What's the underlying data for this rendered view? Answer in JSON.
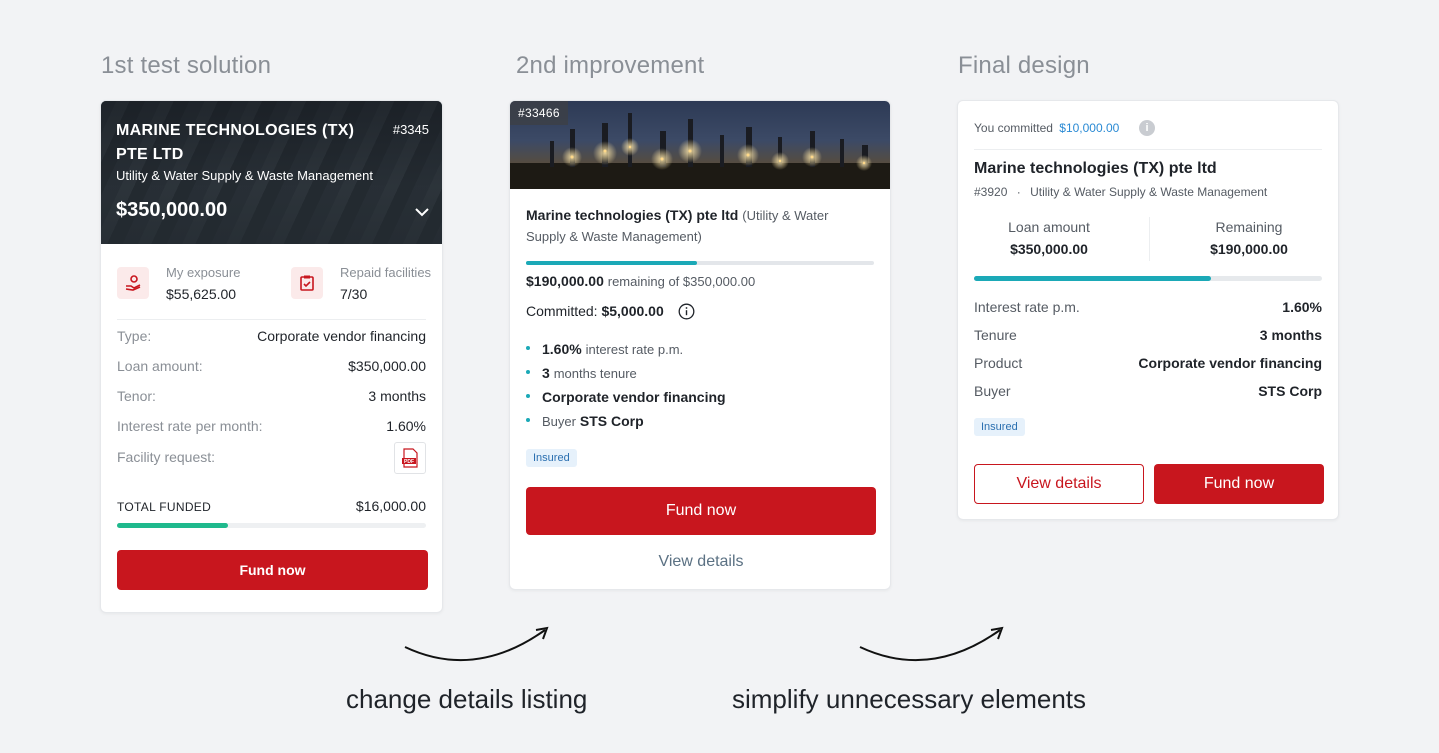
{
  "columns": {
    "first": "1st test solution",
    "second": "2nd improvement",
    "final": "Final design"
  },
  "card1": {
    "company": "MARINE TECHNOLOGIES (TX) PTE LTD",
    "id": "#3345",
    "industry": "Utility & Water Supply & Waste Management",
    "amount": "$350,000.00",
    "exposure_label": "My exposure",
    "exposure_value": "$55,625.00",
    "repaid_label": "Repaid facilities",
    "repaid_value": "7/30",
    "rows": [
      {
        "k": "Type:",
        "v": "Corporate vendor financing"
      },
      {
        "k": "Loan amount:",
        "v": "$350,000.00"
      },
      {
        "k": "Tenor:",
        "v": "3 months"
      },
      {
        "k": "Interest rate per month:",
        "v": "1.60%"
      }
    ],
    "facility_label": "Facility request:",
    "pdf_label": "PDF",
    "total_label": "TOTAL FUNDED",
    "total_value": "$16,000.00",
    "funded_fraction": 0.36,
    "fund_button": "Fund now"
  },
  "card2": {
    "badge": "#33466",
    "company": "Marine technologies (TX) pte ltd",
    "industry": "(Utility & Water Supply & Waste Management)",
    "remaining_amount": "$190,000.00",
    "remaining_text": "remaining of $350,000.00",
    "progress_fraction": 0.49,
    "committed_label": "Committed:",
    "committed_value": "$5,000.00",
    "bullets": [
      {
        "strong": "1.60%",
        "rest": "interest rate p.m."
      },
      {
        "strong": "3",
        "rest": "months tenure"
      },
      {
        "strong": "Corporate vendor financing",
        "rest": ""
      },
      {
        "pre": "Buyer",
        "strong": "STS Corp"
      }
    ],
    "tag": "Insured",
    "fund_button": "Fund now",
    "view_link": "View details"
  },
  "card3": {
    "committed_label": "You committed",
    "committed_value": "$10,000.00",
    "company": "Marine technologies (TX) pte ltd",
    "id": "#3920",
    "separator": "·",
    "industry": "Utility & Water Supply & Waste Management",
    "loan_label": "Loan amount",
    "loan_value": "$350,000.00",
    "remaining_label": "Remaining",
    "remaining_value": "$190,000.00",
    "progress_fraction": 0.68,
    "rows": [
      {
        "k": "Interest rate p.m.",
        "v": "1.60%"
      },
      {
        "k": "Tenure",
        "v": "3 months"
      },
      {
        "k": "Product",
        "v": "Corporate vendor financing"
      },
      {
        "k": "Buyer",
        "v": "STS Corp"
      }
    ],
    "tag": "Insured",
    "view_button": "View details",
    "fund_button": "Fund now"
  },
  "captions": {
    "left": "change details listing",
    "right": "simplify unnecessary elements"
  },
  "colors": {
    "brand_red": "#c8161e",
    "teal": "#1ba9b7",
    "green": "#1fb98d",
    "link_blue": "#2a8ad4"
  }
}
